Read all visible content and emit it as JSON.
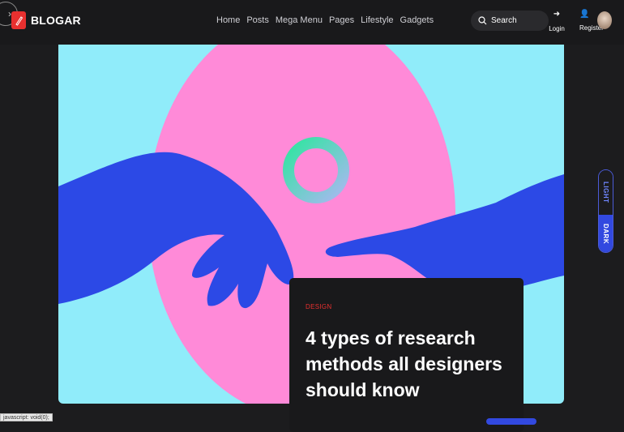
{
  "brand": {
    "name": "BLOGAR"
  },
  "nav": {
    "items": [
      "Home",
      "Posts",
      "Mega Menu",
      "Pages",
      "Lifestyle",
      "Gadgets"
    ]
  },
  "search": {
    "label": "Search"
  },
  "account": {
    "login": "Login",
    "register": "Register"
  },
  "theme_toggle": {
    "light": "LIGHT",
    "dark": "DARK"
  },
  "hero": {
    "category": "DESIGN",
    "title": "4 types of research methods all designers should know"
  },
  "statusbar": {
    "text": "javascript: void(0);"
  },
  "colors": {
    "accent_red": "#e8302f",
    "accent_blue": "#3249e0",
    "hero_bg": "#90ecfa",
    "hero_circle": "#ff8ad8"
  }
}
